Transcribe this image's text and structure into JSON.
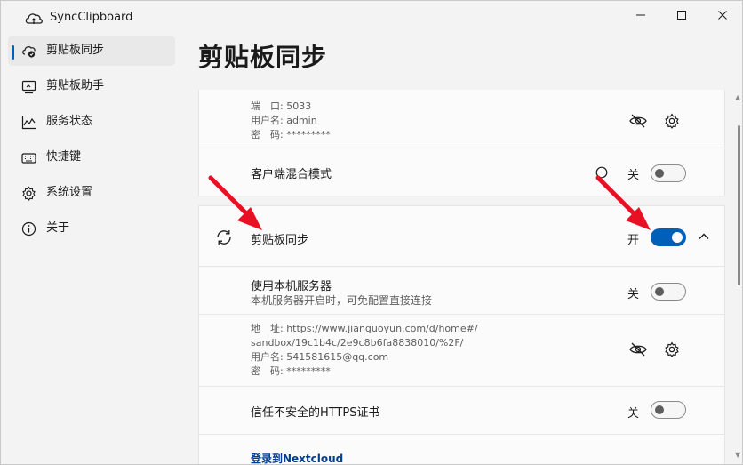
{
  "window": {
    "title": "SyncClipboard",
    "controls": [
      "minimize-icon",
      "maximize-icon",
      "close-icon"
    ]
  },
  "sidebar": {
    "items": [
      {
        "label": "剪贴板同步",
        "icon": "cloud-sync-icon",
        "active": true
      },
      {
        "label": "剪贴板助手",
        "icon": "clipboard-helper-icon",
        "active": false
      },
      {
        "label": "服务状态",
        "icon": "chart-icon",
        "active": false
      },
      {
        "label": "快捷键",
        "icon": "keyboard-icon",
        "active": false
      },
      {
        "label": "系统设置",
        "icon": "gear-icon",
        "active": false
      },
      {
        "label": "关于",
        "icon": "info-icon",
        "active": false
      }
    ]
  },
  "page": {
    "title": "剪贴板同步"
  },
  "server_card": {
    "port_line": "端　口: 5033",
    "user_line": "用户名: admin",
    "pwd_line": "密　码: *********",
    "mixed_mode_label": "客户端混合模式",
    "mixed_mode_state": "关"
  },
  "sync_section": {
    "header_label": "剪贴板同步",
    "header_state": "开",
    "use_local_server_title": "使用本机服务器",
    "use_local_server_desc": "本机服务器开启时，可免配置直接连接",
    "use_local_server_state": "关",
    "addr_line1": "地　址: https://www.jianguoyun.com/d/home#/",
    "addr_line2": "sandbox/19c1b4c/2e9c8b6fa8838010/%2F/",
    "user_line": "用户名: 541581615@qq.com",
    "pwd_line": "密　码: *********",
    "https_label": "信任不安全的HTTPS证书",
    "https_state": "关",
    "nextcloud_link": "登录到Nextcloud"
  },
  "colors": {
    "accent": "#005fb8",
    "annotation_arrow": "#e81123"
  }
}
